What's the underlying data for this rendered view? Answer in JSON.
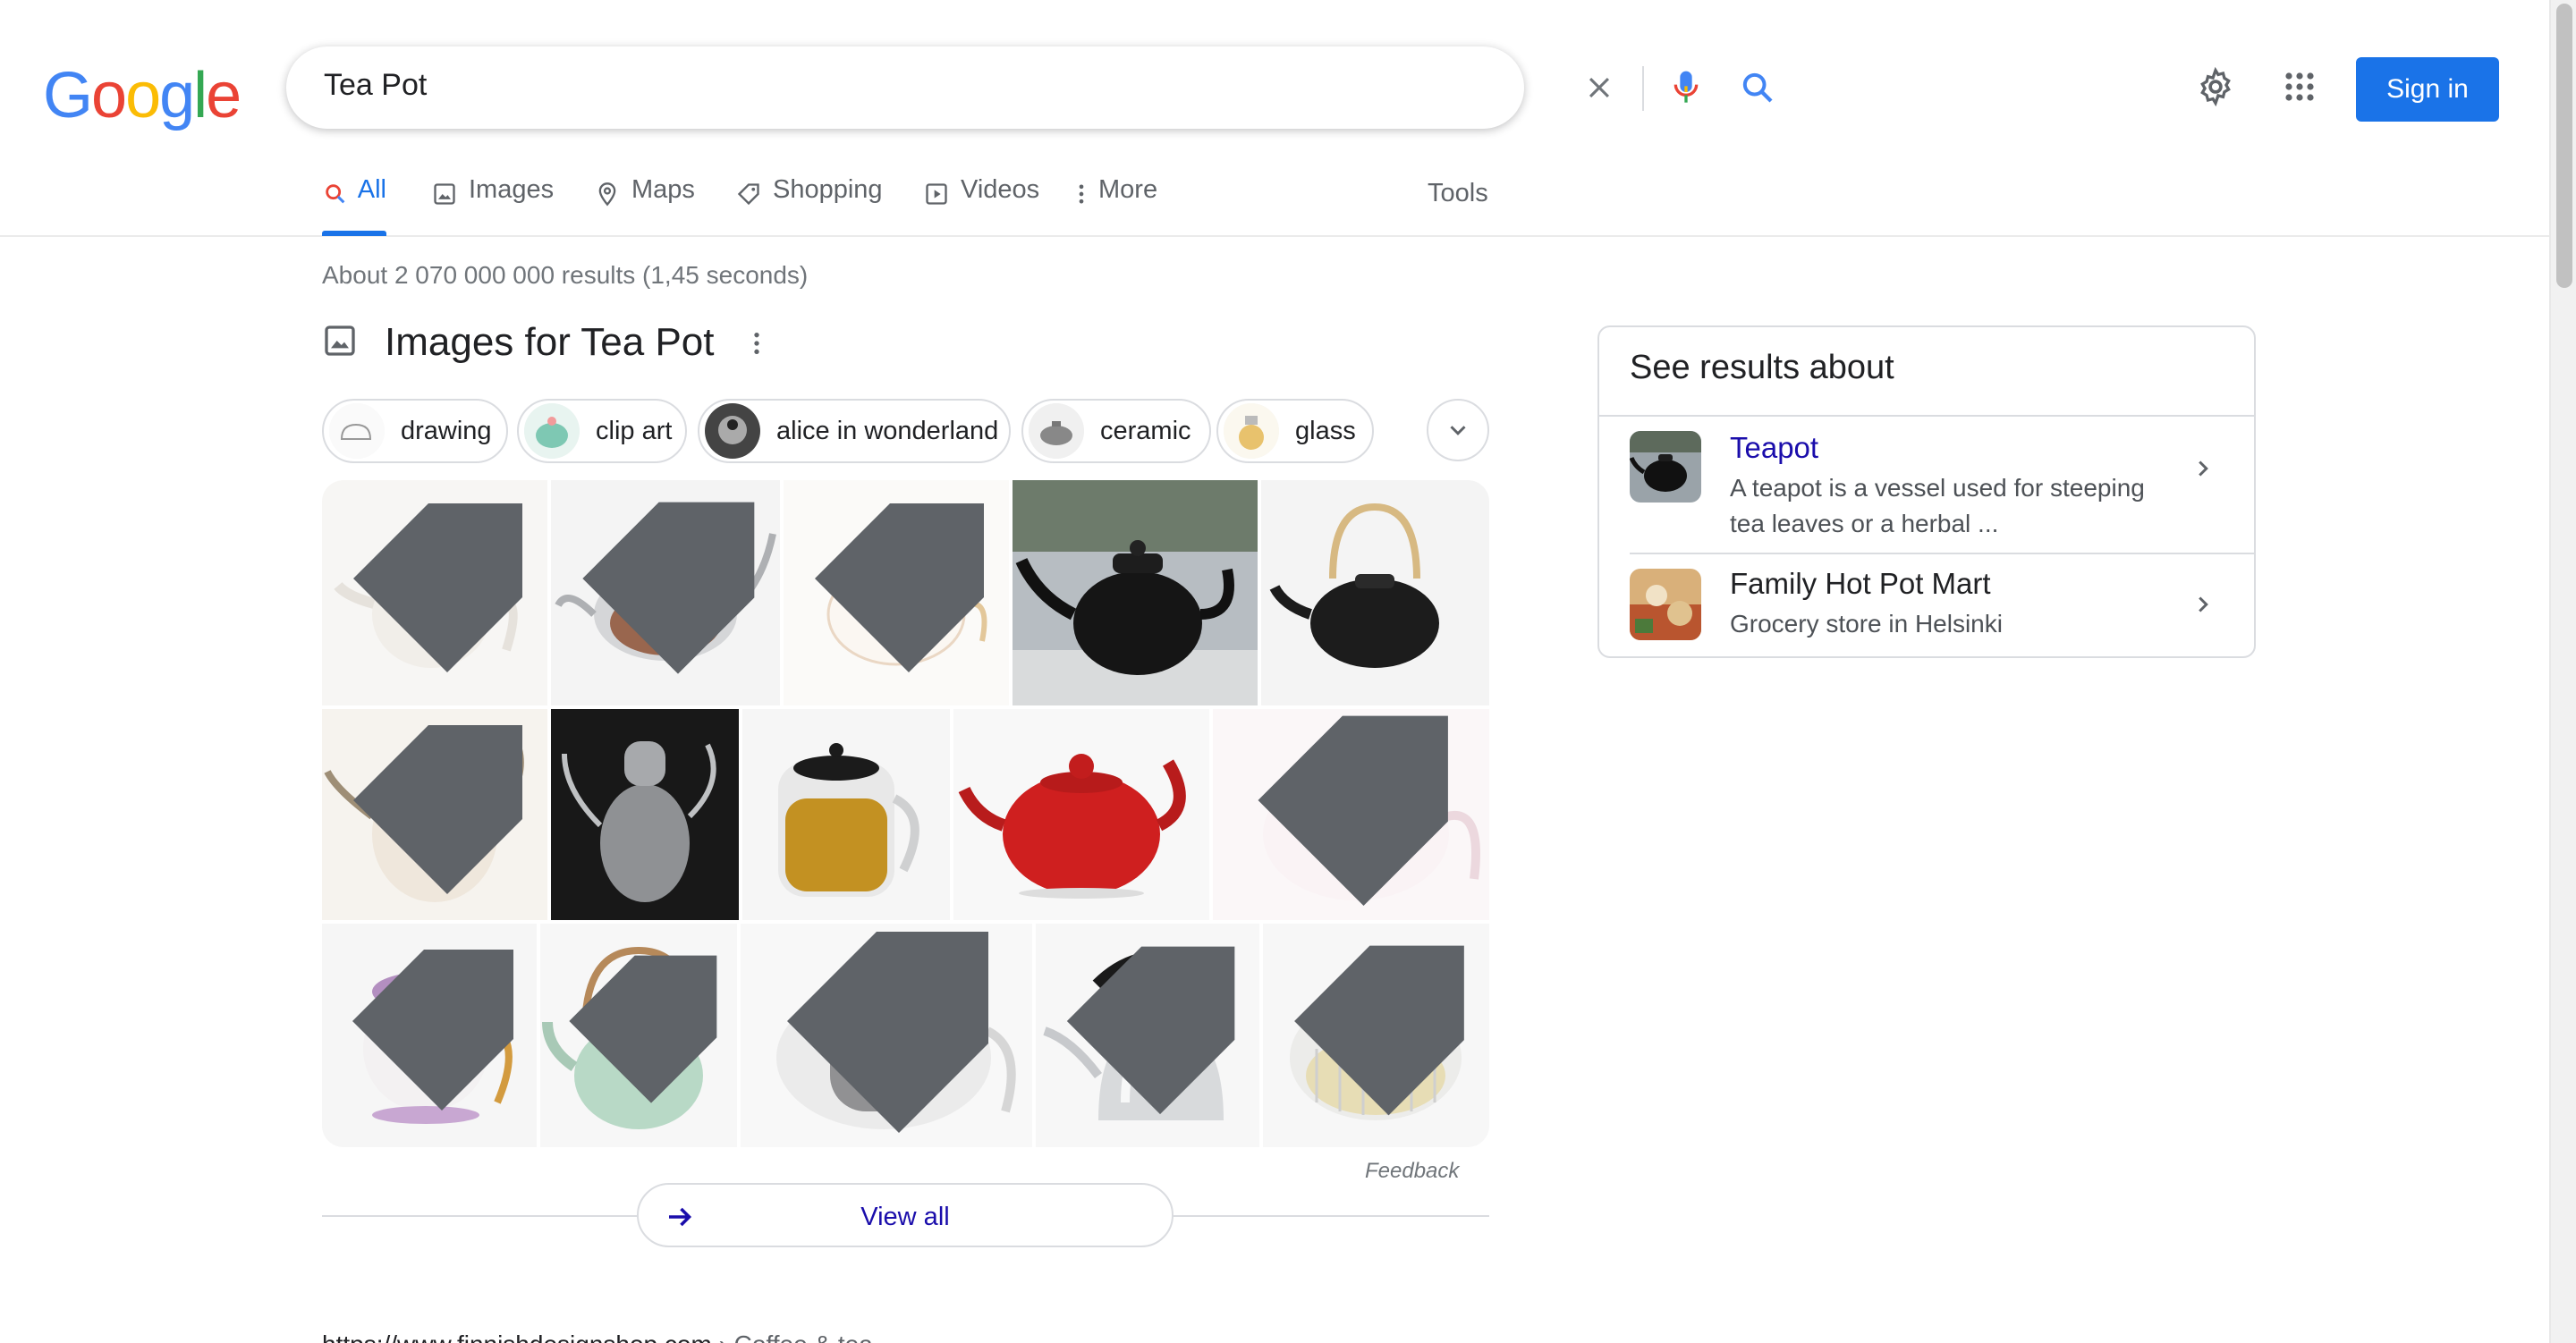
{
  "logo": {
    "text": "Google"
  },
  "search": {
    "query": "Tea Pot"
  },
  "header": {
    "signin_label": "Sign in"
  },
  "tabs": [
    {
      "label": "All",
      "icon": "search-icon",
      "active": true
    },
    {
      "label": "Images",
      "icon": "image-icon"
    },
    {
      "label": "Maps",
      "icon": "map-pin-icon"
    },
    {
      "label": "Shopping",
      "icon": "tag-icon"
    },
    {
      "label": "Videos",
      "icon": "play-icon"
    },
    {
      "label": "More",
      "icon": "kebab-icon"
    }
  ],
  "tools_label": "Tools",
  "stats": "About 2 070 000 000 results (1,45 seconds)",
  "images_section": {
    "title": "Images for Tea Pot",
    "chips": [
      "drawing",
      "clip art",
      "alice in wonderland",
      "ceramic",
      "glass"
    ],
    "feedback": "Feedback",
    "view_all": "View all"
  },
  "result_cite": {
    "url": "https://www.finnishdesignshop.com",
    "crumb": "› Coffee & tea"
  },
  "knowledge_panel": {
    "title": "See results about",
    "items": [
      {
        "name": "Teapot",
        "desc": "A teapot is a vessel used for steeping tea leaves or a herbal ..."
      },
      {
        "name": "Family Hot Pot Mart",
        "desc": "Grocery store in Helsinki"
      }
    ]
  },
  "colors": {
    "accent": "#1a73e8",
    "link": "#1a0dab",
    "text_secondary": "#70757a"
  }
}
